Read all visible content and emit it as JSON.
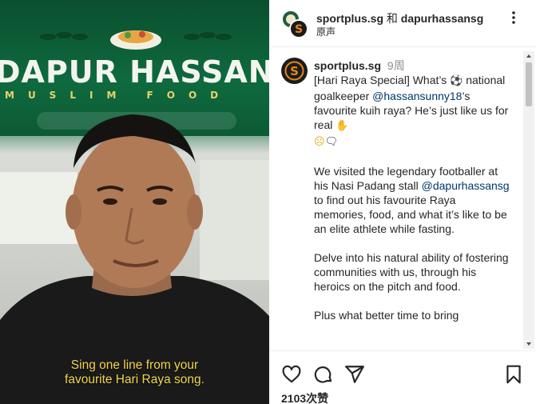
{
  "video": {
    "sign_title": "DAPUR HASSAN",
    "sign_subtitle": "MUSLIM FOOD",
    "caption_line1": "Sing one line from your",
    "caption_line2": "favourite Hari Raya song."
  },
  "header": {
    "user1": "sportplus.sg",
    "connector": "和",
    "user2": "dapurhassansg",
    "audio": "原声"
  },
  "post": {
    "username": "sportplus.sg",
    "time": "9周",
    "p1_a": "[Hari Raya Special] What’s ",
    "p1_b": " national goalkeeper ",
    "p1_mention": "@hassansunny18",
    "p1_c": "’s favourite kuih raya? He’s just like us for real ",
    "p2_a": "We visited the legendary footballer at his Nasi Padang stall ",
    "p2_mention": "@dapurhassansg",
    "p2_b": " to find out his favourite Raya memories, food, and what it’s like to be an elite athlete while fasting.",
    "p3": "Delve into his natural ability of fostering communities with us, through his heroics on the pitch and food.",
    "p4": "Plus what better time to bring"
  },
  "actions": {
    "likes": "2103次赞"
  },
  "icons": [
    "soccer-ball-icon",
    "raised-hand-icon",
    "surprised-face-icon",
    "speech-bubble-icon",
    "heart-icon",
    "comment-icon",
    "share-icon",
    "bookmark-icon",
    "more-icon"
  ],
  "colors": {
    "sign_green": "#0f6a3f",
    "caption_yellow": "#f2d64a",
    "mention_blue": "#00376b",
    "brand_orange": "#e8851a"
  }
}
